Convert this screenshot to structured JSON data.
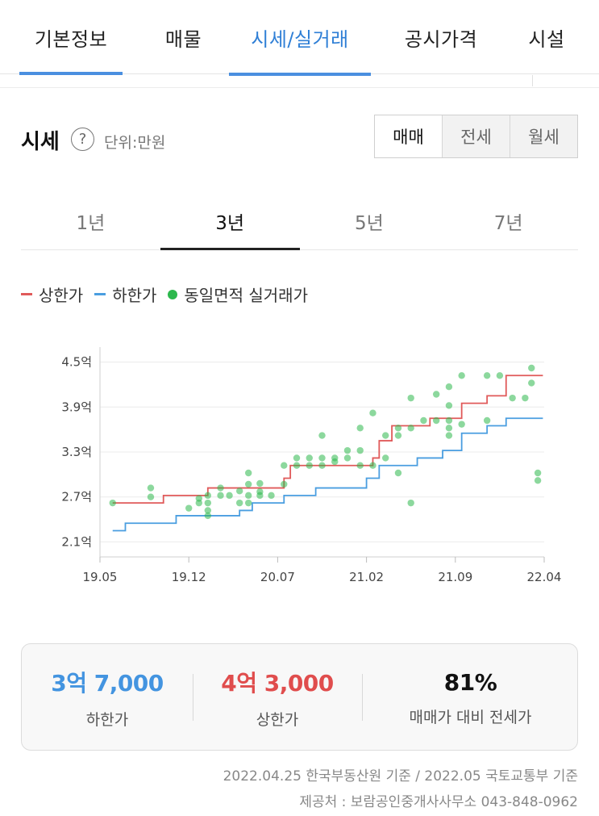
{
  "top_tabs": [
    {
      "label": "기본정보"
    },
    {
      "label": "매물"
    },
    {
      "label": "시세/실거래"
    },
    {
      "label": "공시가격"
    },
    {
      "label": "시설"
    }
  ],
  "header": {
    "title": "시세",
    "help_icon": "?",
    "unit": "단위:만원"
  },
  "deal_types": [
    {
      "label": "매매"
    },
    {
      "label": "전세"
    },
    {
      "label": "월세"
    }
  ],
  "period_tabs": [
    {
      "label": "1년"
    },
    {
      "label": "3년"
    },
    {
      "label": "5년"
    },
    {
      "label": "7년"
    }
  ],
  "legend": {
    "upper": "상한가",
    "lower": "하한가",
    "deals": "동일면적 실거래가"
  },
  "colors": {
    "accent": "#2f7fd6",
    "upper": "#e05a5a",
    "lower": "#4a9ee0",
    "deal": "#2db84d",
    "low_value": "#4394e0",
    "high_value": "#e04d4d"
  },
  "chart_data": {
    "type": "line",
    "x_ticks": [
      "19.05",
      "19.12",
      "20.07",
      "21.02",
      "21.09",
      "22.04"
    ],
    "y_ticks": [
      "4.5억",
      "3.9억",
      "3.3억",
      "2.7억",
      "2.1억"
    ],
    "y_unit": "억",
    "ylim": [
      1.9,
      4.7
    ],
    "xlim_months": [
      0,
      35
    ],
    "upper_steps": [
      [
        1.0,
        2.62
      ],
      [
        5.0,
        2.72
      ],
      [
        8.5,
        2.82
      ],
      [
        13.0,
        2.82
      ],
      [
        14.5,
        2.95
      ],
      [
        15.0,
        3.12
      ],
      [
        21.0,
        3.12
      ],
      [
        21.5,
        3.22
      ],
      [
        22.0,
        3.45
      ],
      [
        23.0,
        3.65
      ],
      [
        25.5,
        3.65
      ],
      [
        26.0,
        3.75
      ],
      [
        28.5,
        3.95
      ],
      [
        30.5,
        4.05
      ],
      [
        32.0,
        4.32
      ],
      [
        34.9,
        4.32
      ]
    ],
    "lower_steps": [
      [
        1.0,
        2.25
      ],
      [
        2.0,
        2.35
      ],
      [
        6.0,
        2.45
      ],
      [
        11.0,
        2.52
      ],
      [
        12.0,
        2.62
      ],
      [
        14.5,
        2.72
      ],
      [
        17.0,
        2.82
      ],
      [
        21.0,
        2.95
      ],
      [
        22.0,
        3.12
      ],
      [
        25.0,
        3.22
      ],
      [
        27.0,
        3.32
      ],
      [
        28.5,
        3.55
      ],
      [
        30.5,
        3.65
      ],
      [
        32.0,
        3.75
      ],
      [
        34.9,
        3.75
      ]
    ],
    "deals": [
      [
        1.0,
        2.62
      ],
      [
        4.0,
        2.7
      ],
      [
        4.0,
        2.82
      ],
      [
        7.0,
        2.55
      ],
      [
        7.8,
        2.62
      ],
      [
        7.8,
        2.68
      ],
      [
        8.5,
        2.72
      ],
      [
        8.5,
        2.52
      ],
      [
        8.5,
        2.62
      ],
      [
        8.5,
        2.45
      ],
      [
        9.5,
        2.72
      ],
      [
        9.5,
        2.82
      ],
      [
        10.2,
        2.72
      ],
      [
        11.0,
        2.62
      ],
      [
        11.0,
        2.78
      ],
      [
        11.7,
        2.62
      ],
      [
        11.7,
        2.72
      ],
      [
        11.7,
        2.87
      ],
      [
        11.7,
        3.02
      ],
      [
        12.6,
        2.72
      ],
      [
        12.6,
        2.77
      ],
      [
        12.6,
        2.88
      ],
      [
        13.5,
        2.72
      ],
      [
        14.5,
        3.12
      ],
      [
        14.5,
        2.87
      ],
      [
        15.5,
        3.12
      ],
      [
        15.5,
        3.22
      ],
      [
        16.5,
        3.12
      ],
      [
        16.5,
        3.22
      ],
      [
        17.5,
        3.12
      ],
      [
        17.5,
        3.22
      ],
      [
        17.5,
        3.52
      ],
      [
        18.5,
        3.17
      ],
      [
        18.5,
        3.22
      ],
      [
        19.5,
        3.22
      ],
      [
        19.5,
        3.32
      ],
      [
        20.5,
        3.32
      ],
      [
        20.5,
        3.62
      ],
      [
        20.5,
        3.12
      ],
      [
        21.5,
        3.82
      ],
      [
        21.5,
        3.12
      ],
      [
        22.5,
        3.52
      ],
      [
        22.5,
        3.22
      ],
      [
        23.5,
        3.62
      ],
      [
        23.5,
        3.52
      ],
      [
        23.5,
        3.02
      ],
      [
        24.5,
        3.62
      ],
      [
        24.5,
        4.02
      ],
      [
        24.5,
        2.62
      ],
      [
        25.5,
        3.72
      ],
      [
        26.5,
        3.72
      ],
      [
        26.5,
        4.07
      ],
      [
        27.5,
        3.62
      ],
      [
        27.5,
        3.92
      ],
      [
        27.5,
        4.17
      ],
      [
        27.5,
        3.72
      ],
      [
        27.5,
        3.52
      ],
      [
        28.5,
        4.32
      ],
      [
        28.5,
        3.67
      ],
      [
        30.5,
        4.32
      ],
      [
        30.5,
        3.72
      ],
      [
        31.5,
        4.32
      ],
      [
        32.5,
        4.02
      ],
      [
        33.5,
        4.02
      ],
      [
        34.0,
        4.42
      ],
      [
        34.0,
        4.22
      ],
      [
        34.5,
        3.02
      ],
      [
        34.5,
        2.92
      ]
    ]
  },
  "summary": {
    "low_value": "3억 7,000",
    "low_label": "하한가",
    "high_value": "4억 3,000",
    "high_label": "상한가",
    "ratio_value": "81%",
    "ratio_label": "매매가 대비 전세가"
  },
  "footer": {
    "line1": "2022.04.25 한국부동산원 기준 / 2022.05 국토교통부 기준",
    "line2": "제공처 : 보람공인중개사사무소 043-848-0962"
  }
}
